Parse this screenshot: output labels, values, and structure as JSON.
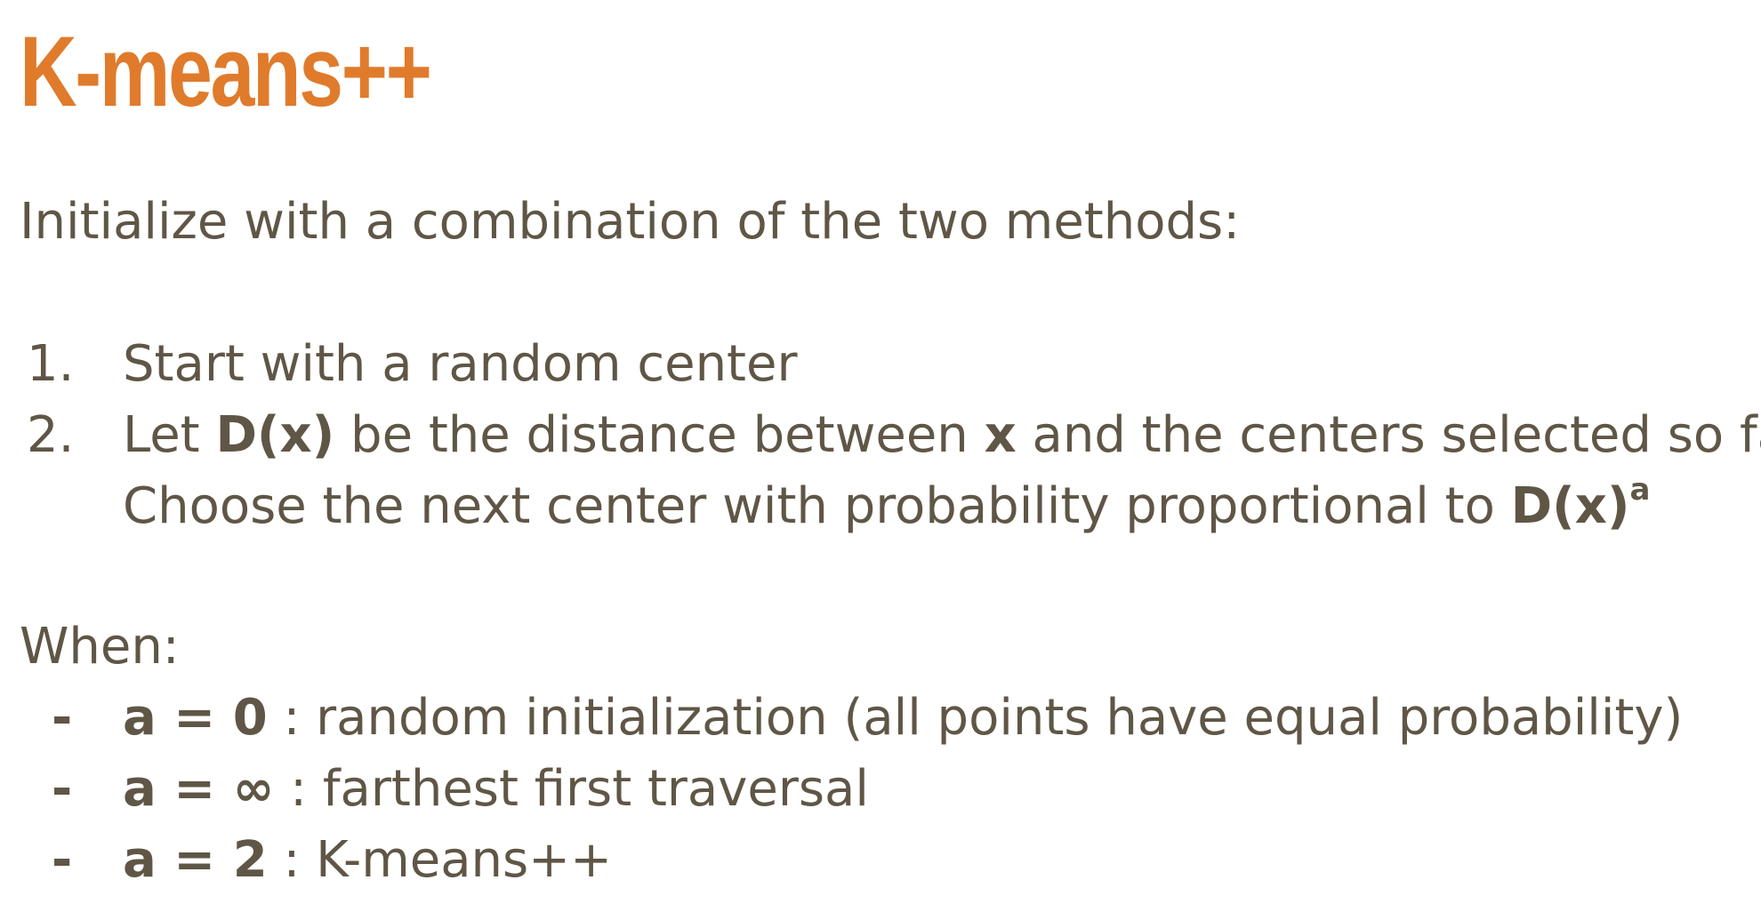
{
  "title": "K-means++",
  "intro": "Initialize with a combination of the two methods:",
  "steps": [
    {
      "number": "1.",
      "text": "Start with a random center"
    },
    {
      "number": "2.",
      "pre": "Let ",
      "dx": "D(x)",
      "mid1": " be the distance between ",
      "x": "x",
      "mid2": " and the centers selected so far.",
      "line2_pre": "Choose the next center with probability proportional to ",
      "line2_bold": "D(x)",
      "line2_sup": "a"
    }
  ],
  "when_label": "When:",
  "conditions": [
    {
      "bullet": "-",
      "cond": "a = 0",
      "desc": " : random initialization (all points have equal probability)"
    },
    {
      "bullet": "-",
      "cond": "a = ∞",
      "desc": " : farthest first traversal"
    },
    {
      "bullet": "-",
      "cond": "a = 2",
      "desc": " : K-means++"
    }
  ],
  "colors": {
    "title": "#e07b2c",
    "text": "#5f5646"
  }
}
